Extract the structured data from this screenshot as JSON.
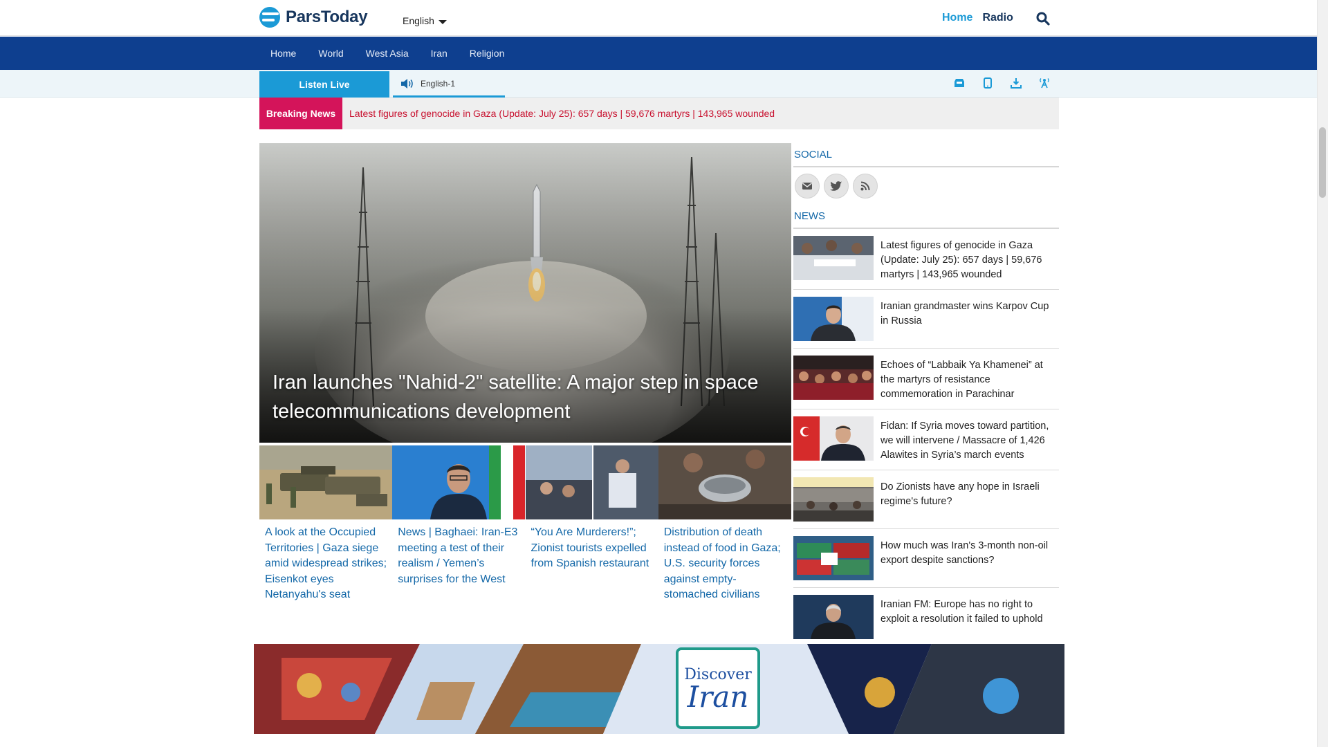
{
  "header": {
    "logo_text": "ParsToday",
    "language": "English",
    "links": {
      "home": "Home",
      "radio": "Radio"
    }
  },
  "nav": {
    "items": [
      {
        "label": "Home"
      },
      {
        "label": "World"
      },
      {
        "label": "West Asia"
      },
      {
        "label": "Iran"
      },
      {
        "label": "Religion"
      }
    ]
  },
  "live": {
    "listen_label": "Listen Live",
    "channel": "English-1",
    "tool_icons": [
      "inbox-icon",
      "mobile-icon",
      "download-icon",
      "antenna-icon"
    ]
  },
  "breaking": {
    "label": "Breaking News",
    "text": "Latest figures of genocide in Gaza (Update: July 25): 657 days | 59,676 martyrs | 143,965 wounded"
  },
  "hero": {
    "title": "Iran launches \"Nahid-2\" satellite: A major step in space telecommunications development"
  },
  "cards": [
    {
      "title": "A look at the Occupied Territories | Gaza siege amid widespread strikes; Eisenkot eyes Netanyahu's seat"
    },
    {
      "title": "News | Baghaei: Iran-E3 meeting a test of their realism / Yemen’s surprises for the West"
    },
    {
      "title": "“You Are Murderers!”; Zionist tourists expelled from Spanish restaurant"
    },
    {
      "title": "Distribution of death instead of food in Gaza; U.S. security forces against empty-stomached civilians"
    }
  ],
  "sidebar": {
    "social_heading": "SOCIAL",
    "social_icons": [
      "mail-icon",
      "twitter-icon",
      "rss-icon"
    ],
    "news_heading": "NEWS",
    "news": [
      {
        "title": "Latest figures of genocide in Gaza (Update: July 25): 657 days | 59,676 martyrs | 143,965 wounded"
      },
      {
        "title": "Iranian grandmaster wins Karpov Cup in Russia"
      },
      {
        "title": "Echoes of “Labbaik Ya Khamenei” at the martyrs of resistance commemoration in Parachinar"
      },
      {
        "title": "Fidan: If Syria moves toward partition, we will intervene / Massacre of 1,426 Alawites in Syria’s march events"
      },
      {
        "title": "Do Zionists have any hope in Israeli regime's future?"
      },
      {
        "title": "How much was Iran's 3-month non-oil export despite sanctions?"
      },
      {
        "title": "Iranian FM: Europe has no right to exploit a resolution it failed to uphold"
      }
    ]
  },
  "banner": {
    "line1": "Discover",
    "line2": "Iran"
  },
  "colors": {
    "brand_blue": "#1b9ad6",
    "nav_blue": "#0e3f8f",
    "breaking_red": "#d4145a",
    "link_blue": "#1468a8"
  }
}
